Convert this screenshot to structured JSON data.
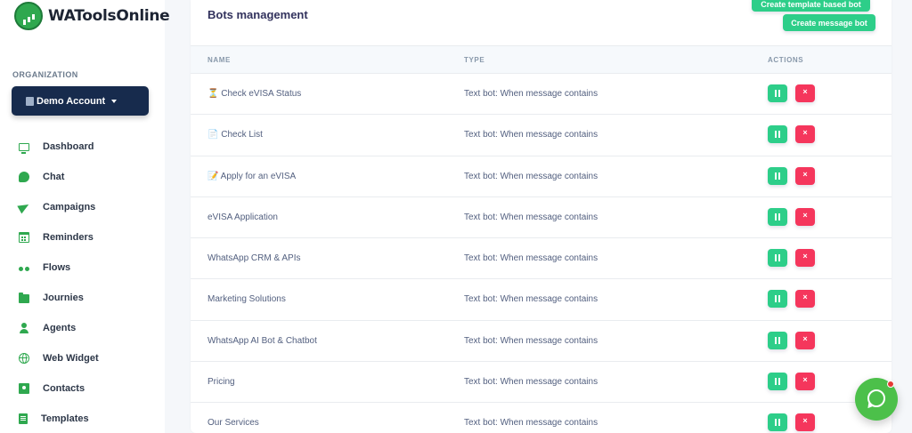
{
  "brand": {
    "name": "WAToolsOnline",
    "accent": "#2fa84f"
  },
  "organization": {
    "label": "ORGANIZATION",
    "current": "Demo Account"
  },
  "nav": [
    {
      "label": "Dashboard",
      "icon": "monitor-icon"
    },
    {
      "label": "Chat",
      "icon": "chat-icon"
    },
    {
      "label": "Campaigns",
      "icon": "send-icon"
    },
    {
      "label": "Reminders",
      "icon": "calendar-icon"
    },
    {
      "label": "Flows",
      "icon": "flow-icon"
    },
    {
      "label": "Journies",
      "icon": "folder-icon"
    },
    {
      "label": "Agents",
      "icon": "user-icon"
    },
    {
      "label": "Web Widget",
      "icon": "globe-icon"
    },
    {
      "label": "Contacts",
      "icon": "contacts-icon"
    },
    {
      "label": "Templates",
      "icon": "document-icon"
    }
  ],
  "main": {
    "title": "Bots management",
    "create_template_label": "Create template based bot",
    "create_message_label": "Create message bot",
    "columns": {
      "name": "NAME",
      "type": "TYPE",
      "actions": "ACTIONS"
    },
    "bots": [
      {
        "name": "⏳ Check eVISA Status",
        "type": "Text bot: When message contains"
      },
      {
        "name": "📄 Check List",
        "type": "Text bot: When message contains"
      },
      {
        "name": "📝 Apply for an eVISA",
        "type": "Text bot: When message contains"
      },
      {
        "name": "eVISA Application",
        "type": "Text bot: When message contains"
      },
      {
        "name": "WhatsApp CRM & APIs",
        "type": "Text bot: When message contains"
      },
      {
        "name": "Marketing Solutions",
        "type": "Text bot: When message contains"
      },
      {
        "name": "WhatsApp AI Bot & Chatbot",
        "type": "Text bot: When message contains"
      },
      {
        "name": "Pricing",
        "type": "Text bot: When message contains"
      },
      {
        "name": "Our Services",
        "type": "Text bot: When message contains"
      }
    ]
  },
  "colors": {
    "success": "#2dce89",
    "danger": "#f5365c",
    "navy": "#172b4d",
    "whatsapp": "#4cc04a"
  }
}
